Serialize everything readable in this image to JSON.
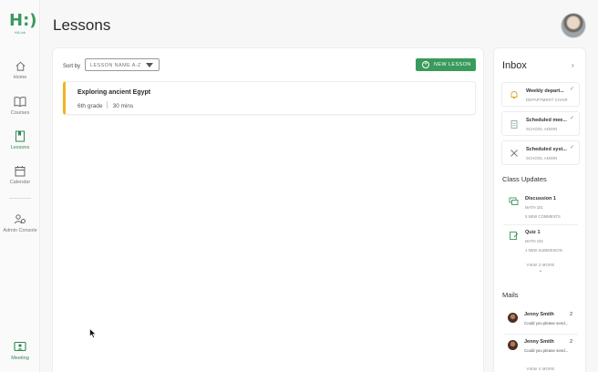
{
  "nav": {
    "logo_text": "H:)",
    "logo_sub": "HILink",
    "items": [
      {
        "label": "Home",
        "icon": "home-icon"
      },
      {
        "label": "Courses",
        "icon": "book-icon"
      },
      {
        "label": "Lessons",
        "icon": "bookmark-icon",
        "active": true
      },
      {
        "label": "Calendar",
        "icon": "calendar-icon"
      },
      {
        "label": "Admin Console",
        "icon": "admin-icon"
      },
      {
        "label": "Meeting",
        "icon": "meeting-icon",
        "active": true
      }
    ]
  },
  "header": {
    "title": "Lessons"
  },
  "toolbar": {
    "sort_label": "Sort by",
    "sort_value": "LESSON NAME A-Z",
    "new_button": "NEW LESSON"
  },
  "lessons": [
    {
      "title": "Exploring ancient Egypt",
      "grade": "6th grade",
      "duration": "30 mins"
    }
  ],
  "inbox": {
    "title": "Inbox",
    "items": [
      {
        "title": "Weekly depart...",
        "sub": "DEPARTMENT CHAIR",
        "icon": "bell-icon"
      },
      {
        "title": "Scheduled mee...",
        "sub": "SCHOOL ADMIN",
        "icon": "clipboard-icon"
      },
      {
        "title": "Scheduled syst...",
        "sub": "SCHOOL ADMIN",
        "icon": "tools-icon"
      }
    ]
  },
  "class_updates": {
    "title": "Class Updates",
    "items": [
      {
        "title": "Discussion 1",
        "course": "MATH 101",
        "detail": "5 NEW COMMENTS",
        "icon": "discussion-icon"
      },
      {
        "title": "Quiz 1",
        "course": "MATH 102",
        "detail": "1 NEW SUBMISSION",
        "icon": "quiz-icon"
      }
    ],
    "view_more": "VIEW 3 MORE"
  },
  "mails": {
    "title": "Mails",
    "items": [
      {
        "name": "Jenny Smith",
        "count": "2",
        "preview": "Could you please send..."
      },
      {
        "name": "Jenny Smith",
        "count": "2",
        "preview": "Could you please send..."
      }
    ],
    "view_more": "VIEW 4 MORE"
  },
  "colors": {
    "accent": "#3a9a5b",
    "lesson_stripe": "#f0b323"
  }
}
